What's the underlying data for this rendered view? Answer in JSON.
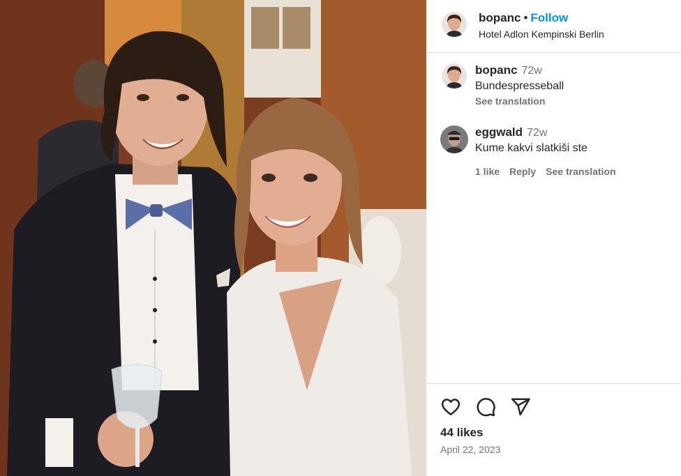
{
  "post": {
    "username": "bopanc",
    "separator": "•",
    "follow_label": "Follow",
    "location": "Hotel Adlon Kempinski Berlin"
  },
  "comments": [
    {
      "username": "bopanc",
      "time": "72w",
      "text": "Bundespresseball",
      "see_translation": "See translation"
    },
    {
      "username": "eggwald",
      "time": "72w",
      "text": "Kume kakvi slatkiši ste",
      "likes": "1 like",
      "reply": "Reply",
      "see_translation": "See translation"
    }
  ],
  "actions": {
    "icons": [
      "heart-icon",
      "comment-icon",
      "share-icon"
    ],
    "likes": "44 likes",
    "date": "April 22, 2023"
  },
  "colors": {
    "follow_blue": "#0095f6",
    "muted_text": "#737373",
    "divider": "#dbdbdb"
  }
}
